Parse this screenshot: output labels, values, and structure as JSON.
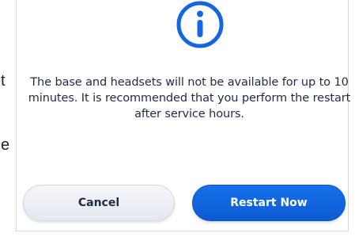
{
  "background": {
    "fragment_top": "t",
    "fragment_bottom": "e"
  },
  "dialog": {
    "icon": "info-icon",
    "message": "The base and headsets will not be available for up to 10 minutes. It is recommended that you perform the restart after service hours.",
    "buttons": {
      "cancel_label": "Cancel",
      "restart_label": "Restart Now"
    }
  },
  "colors": {
    "accent": "#0d5bd3",
    "icon": "#1565e0",
    "text": "#1f2a44"
  }
}
